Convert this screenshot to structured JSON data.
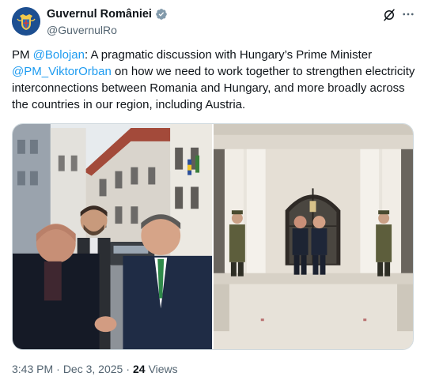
{
  "author": {
    "display_name": "Guvernul României",
    "handle": "@GuvernulRo",
    "avatar_icon": "romanian-coat-of-arms-icon",
    "verified_icon": "verified-badge-icon",
    "verified_color": "#829aab"
  },
  "header_icons": [
    "grok-icon",
    "more-icon"
  ],
  "tweet": {
    "prefix": "PM ",
    "mention1": "@Bolojan",
    "text1": ": A pragmatic discussion with Hungary’s Prime Minister ",
    "mention2": "@PM_ViktorOrban",
    "text2": " on how we need to work together to strengthen electricity interconnections between Romania and Hungary, and more broadly across the countries in our region, including Austria."
  },
  "meta": {
    "time": "3:43 PM",
    "separator1": "·",
    "date": "Dec 3, 2025",
    "separator2": "·",
    "views_count": "24",
    "views_label": "Views"
  },
  "colors": {
    "link": "#1d9bf0",
    "text": "#0f1419",
    "secondary": "#536471",
    "avatar_bg": "#1d4f91"
  }
}
